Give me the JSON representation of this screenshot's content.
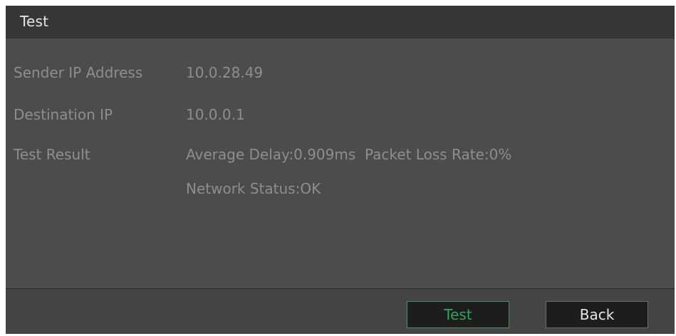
{
  "dialog": {
    "title": "Test"
  },
  "fields": {
    "sender_ip": {
      "label": "Sender IP Address",
      "value": "10.0.28.49"
    },
    "destination_ip": {
      "label": "Destination IP",
      "value": "10.0.0.1"
    },
    "test_result": {
      "label": "Test Result",
      "line1": "Average Delay:0.909ms  Packet Loss Rate:0%",
      "line2": "Network Status:OK"
    }
  },
  "buttons": {
    "test_label": "Test",
    "back_label": "Back"
  },
  "colors": {
    "dialog_bg": "#4b4c4b",
    "titlebar_bg": "#363838",
    "text_muted": "#8d8e8d",
    "accent_green": "#2fa55b"
  }
}
